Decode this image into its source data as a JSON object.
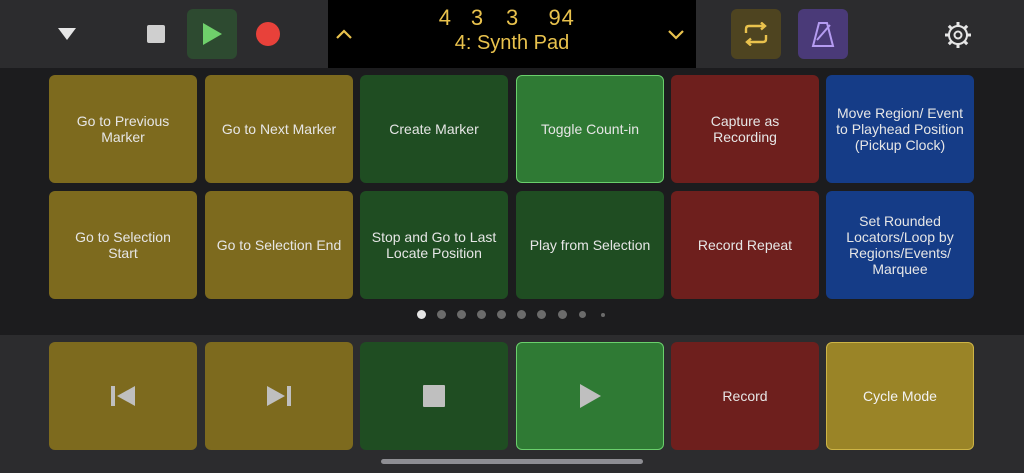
{
  "lcd": {
    "bar": "4",
    "beat": "3",
    "division": "3",
    "tempo": "94",
    "track": "4: Synth Pad"
  },
  "pads": [
    {
      "label": "Go to Previous Marker",
      "color": "gold"
    },
    {
      "label": "Go to Next Marker",
      "color": "gold"
    },
    {
      "label": "Create Marker",
      "color": "green"
    },
    {
      "label": "Toggle Count-in",
      "color": "greenlit"
    },
    {
      "label": "Capture as Recording",
      "color": "red"
    },
    {
      "label": "Move Region/ Event to Playhead Position (Pickup Clock)",
      "color": "blue"
    },
    {
      "label": "Go to Selection Start",
      "color": "gold"
    },
    {
      "label": "Go to Selection End",
      "color": "gold"
    },
    {
      "label": "Stop and Go to Last Locate Position",
      "color": "green"
    },
    {
      "label": "Play from Selection",
      "color": "green"
    },
    {
      "label": "Record Repeat",
      "color": "red"
    },
    {
      "label": "Set Rounded Locators/Loop by Regions/Events/ Marquee",
      "color": "blue"
    }
  ],
  "page_indicator": {
    "count": 10,
    "current": 1
  },
  "bottom": {
    "record_label": "Record",
    "cycle_label": "Cycle Mode"
  },
  "colors": {
    "lcd_text": "#e9c24d",
    "record_red": "#e8413a",
    "play_green": "#6fd06b"
  }
}
